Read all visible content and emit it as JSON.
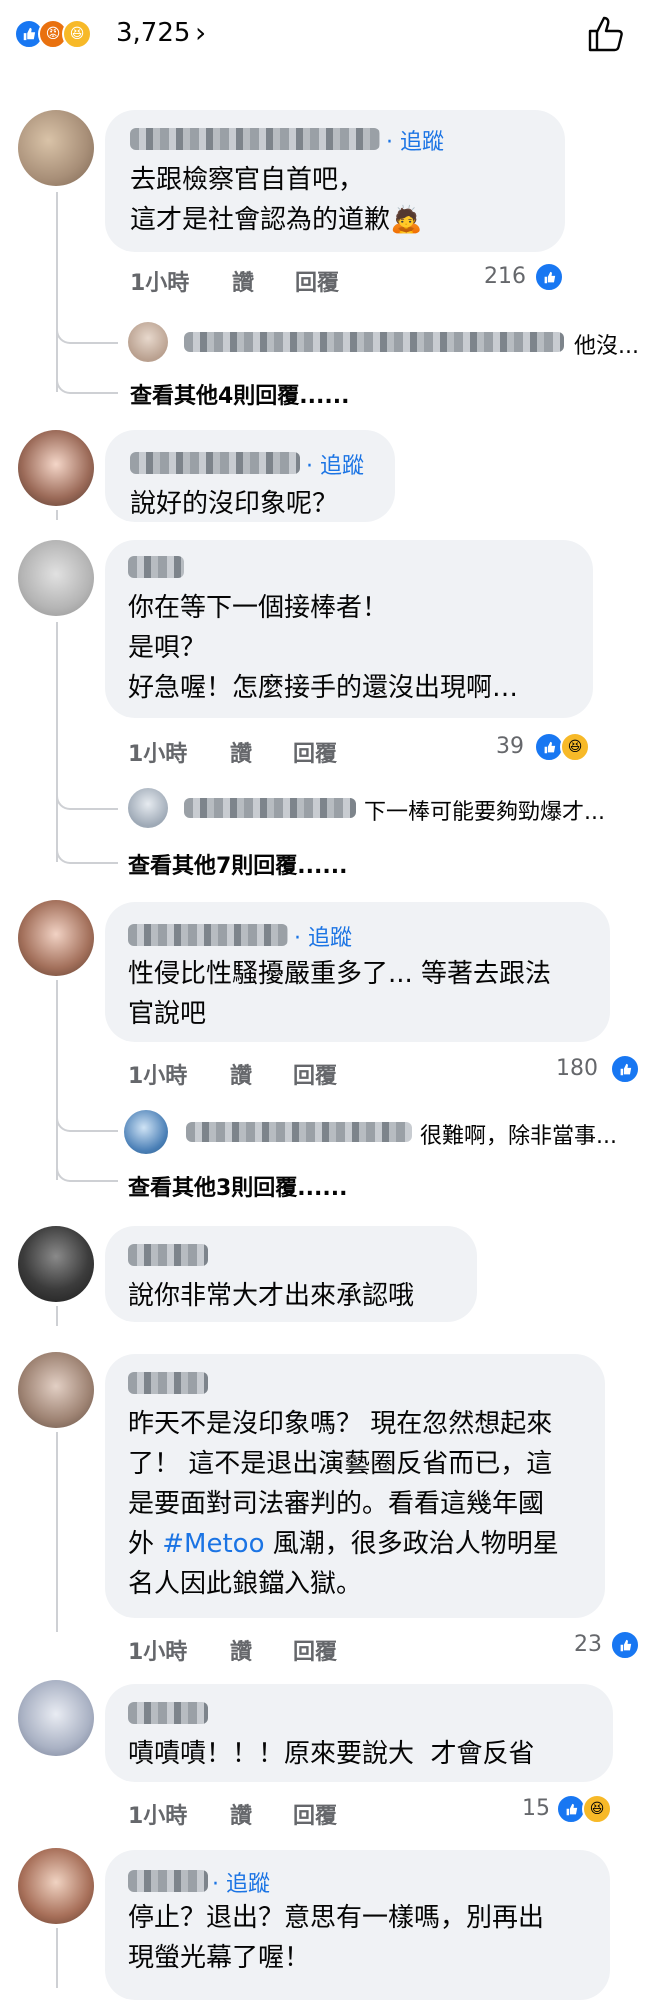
{
  "reactions": {
    "count": "3,725",
    "icons": [
      "like-icon",
      "angry-icon",
      "haha-icon"
    ]
  },
  "colors": {
    "link": "#1b74e4",
    "like": "#1877f2",
    "haha": "#f7b928",
    "angry": "#e9710f",
    "bubble": "#f0f2f5",
    "meta": "#65676b"
  },
  "labels": {
    "follow": "· 追蹤",
    "like": "讚",
    "reply": "回覆"
  },
  "comments": [
    {
      "text": "去跟檢察官自首吧，\n這才是社會認為的道歉🙇",
      "time": "1小時",
      "likes": "216",
      "reply_preview": "他沒...",
      "more_replies": "查看其他4則回覆......"
    },
    {
      "text": "說好的沒印象呢？"
    },
    {
      "text": "你在等下一個接棒者！\n是唄？\n好急喔！怎麼接手的還沒出現啊…",
      "time": "1小時",
      "likes": "39",
      "reply_preview": "下一棒可能要夠勁爆才...",
      "more_replies": "查看其他7則回覆......"
    },
    {
      "text": "性侵比性騷擾嚴重多了... 等著去跟法\n官說吧",
      "time": "1小時",
      "likes": "180",
      "reply_preview": "很難啊，除非當事...",
      "more_replies": "查看其他3則回覆......"
    },
    {
      "text": "說你非常大才出來承認哦"
    },
    {
      "text_before": "昨天不是沒印象嗎？ 現在忽然想起來\n了！ 這不是退出演藝圈反省而已，這\n是要面對司法審判的。看看這幾年國\n外 ",
      "hashtag": "#Metoo",
      "text_after": " 風潮，很多政治人物明星\n名人因此鋃鐺入獄。",
      "time": "1小時",
      "likes": "23"
    },
    {
      "text": "嘖嘖嘖！！！原來要說大  才會反省",
      "time": "1小時",
      "likes": "15"
    },
    {
      "text": "停止？退出？意思有一樣嗎，別再出\n現螢光幕了喔！"
    }
  ]
}
